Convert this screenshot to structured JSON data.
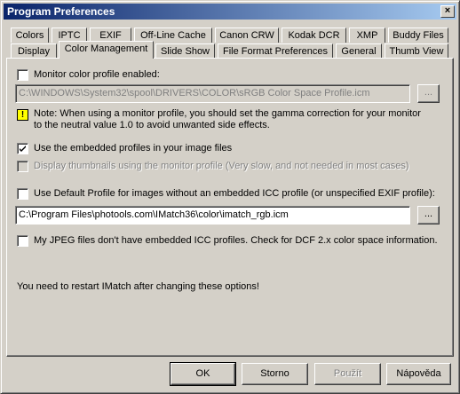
{
  "window": {
    "title": "Program Preferences",
    "close_glyph": "×"
  },
  "tabs_row1": [
    "Colors",
    "IPTC",
    "EXIF",
    "Off-Line Cache",
    "Canon CRW",
    "Kodak DCR",
    "XMP",
    "Buddy Files"
  ],
  "tabs_row2": [
    "Display",
    "Color Management",
    "Slide Show",
    "File Format Preferences",
    "General",
    "Thumb View"
  ],
  "active_tab": "Color Management",
  "color_management": {
    "monitor_profile_label": "Monitor color profile enabled:",
    "monitor_profile_path": "C:\\WINDOWS\\System32\\spool\\DRIVERS\\COLOR\\sRGB Color Space Profile.icm",
    "note_line1": "Note: When using a monitor profile, you should set the gamma correction for your monitor",
    "note_line2": "to  the neutral value 1.0 to avoid unwanted side effects.",
    "embedded_label": "Use the embedded profiles in your image files",
    "thumbnails_label": "Display thumbnails using the monitor profile (Very slow, and not needed in most cases)",
    "default_profile_label": "Use Default Profile for images without an embedded ICC profile (or unspecified EXIF profile):",
    "default_profile_path": "C:\\Program Files\\photools.com\\IMatch36\\color\\imatch_rgb.icm",
    "jpeg_label": "My JPEG files don't have embedded ICC profiles. Check for DCF 2.x color space information.",
    "restart_note": "You need to restart IMatch after changing these options!",
    "browse_label": "...",
    "warning_glyph": "!"
  },
  "checkboxes": {
    "monitor_profile": false,
    "embedded": true,
    "thumbnails": false,
    "default_profile": false,
    "jpeg": false
  },
  "buttons": {
    "ok": "OK",
    "cancel": "Storno",
    "apply": "Použít",
    "help": "Nápověda"
  }
}
